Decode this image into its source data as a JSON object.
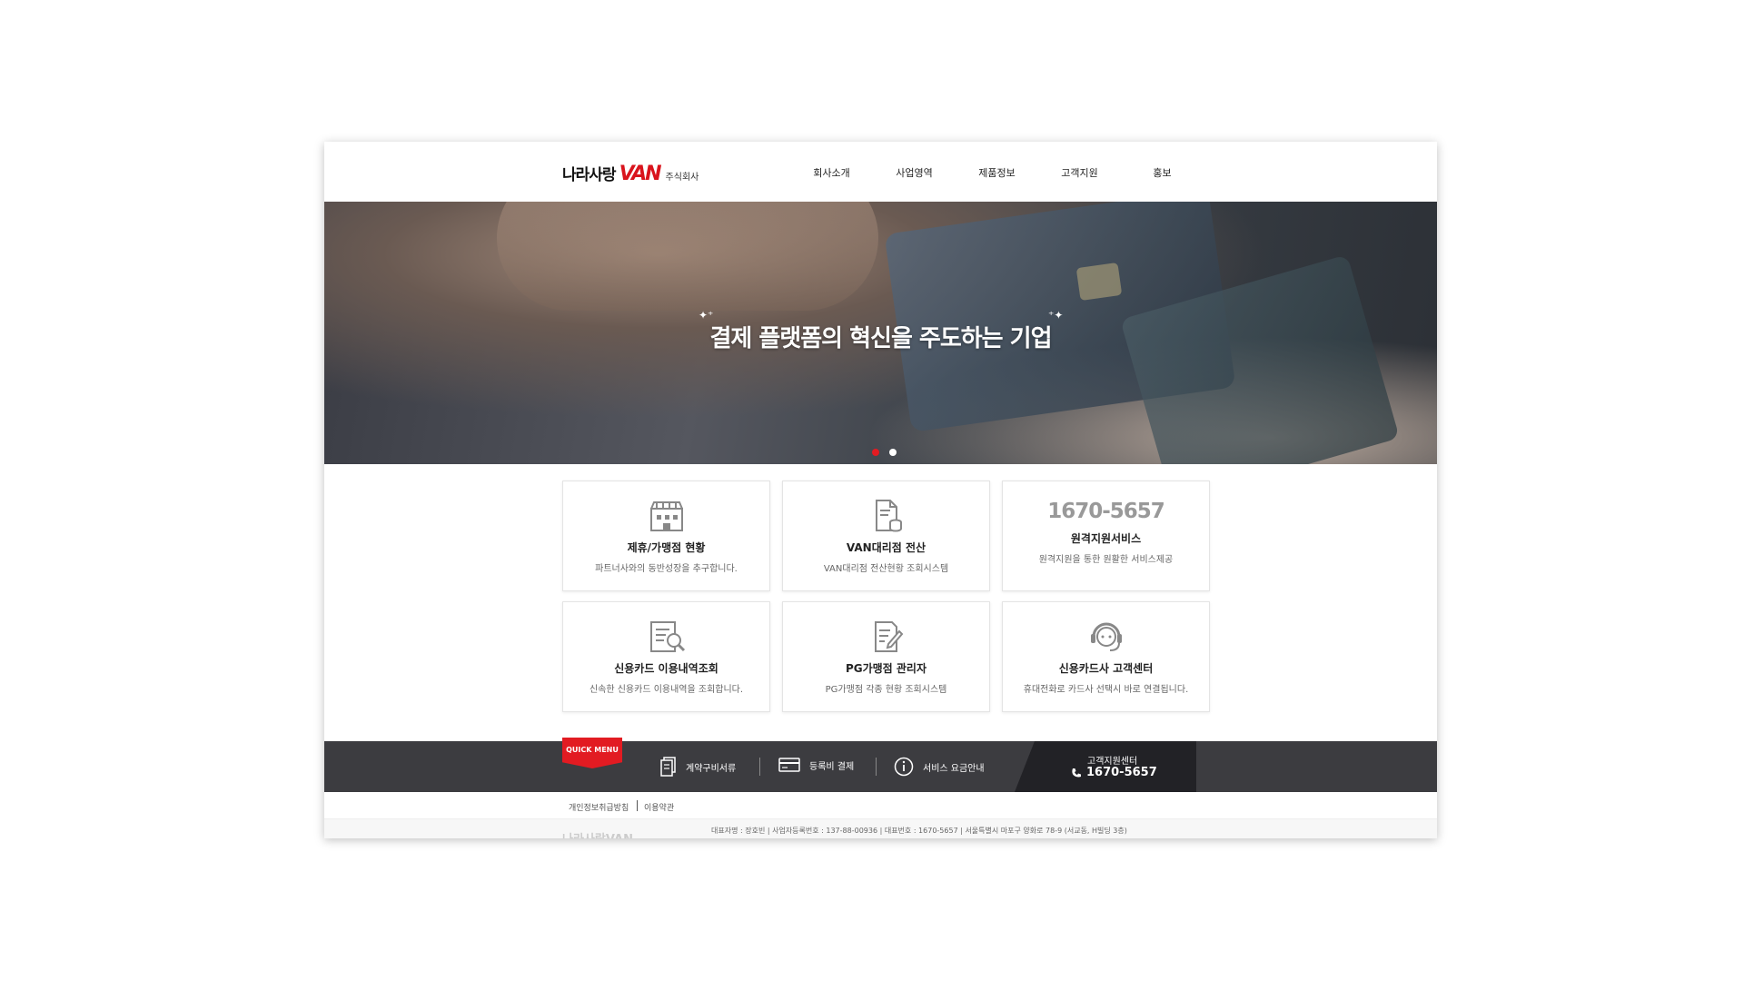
{
  "header": {
    "logo_main": "나라사랑",
    "logo_van": "VAN",
    "logo_sub": "주식회사",
    "nav": [
      "회사소개",
      "사업영역",
      "제품정보",
      "고객지원",
      "홍보"
    ]
  },
  "hero": {
    "title": "결제 플랫폼의 혁신을 주도하는 기업",
    "slides": 2,
    "active_slide": 1
  },
  "services": [
    {
      "title": "제휴/가맹점 현황",
      "desc": "파트너사와의 동반성장을 추구합니다.",
      "icon": "store-icon"
    },
    {
      "title": "VAN대리점 전산",
      "desc": "VAN대리점 전산현황 조회시스템",
      "icon": "document-coins-icon"
    },
    {
      "phone": "1670-5657",
      "title": "원격지원서비스",
      "desc": "원격지원을 통한 원활한 서비스제공"
    },
    {
      "title": "신용카드 이용내역조회",
      "desc": "신속한 신용카드 이용내역을 조회합니다.",
      "icon": "receipt-search-icon"
    },
    {
      "title": "PG가맹점 관리자",
      "desc": "PG가맹점 각종 현황 조회시스템",
      "icon": "document-edit-icon"
    },
    {
      "title": "신용카드사 고객센터",
      "desc": "휴대전화로 카드사 선택시 바로 연결됩니다.",
      "icon": "headset-icon"
    }
  ],
  "quick_menu": {
    "tag": "QUICK MENU",
    "items": [
      {
        "label": "계약구비서류",
        "icon": "document-icon"
      },
      {
        "label": "등록비 결제",
        "icon": "card-icon"
      },
      {
        "label": "서비스 요금안내",
        "icon": "info-icon"
      }
    ],
    "center_label": "고객지원센터",
    "center_phone": "1670-5657"
  },
  "footer": {
    "links": [
      "개인정보취급방침",
      "이용약관"
    ],
    "info": "대표자명 : 장호빈  |  사업자등록번호 : 137-88-00936  |  대표번호 : 1670-5657  |  서울특별시 마포구 양화로 78-9 (서교동, H빌딩 3층)",
    "logo": "나라사랑VAN"
  },
  "colors": {
    "accent": "#e21b22",
    "quick_bg": "#3c3c40"
  }
}
